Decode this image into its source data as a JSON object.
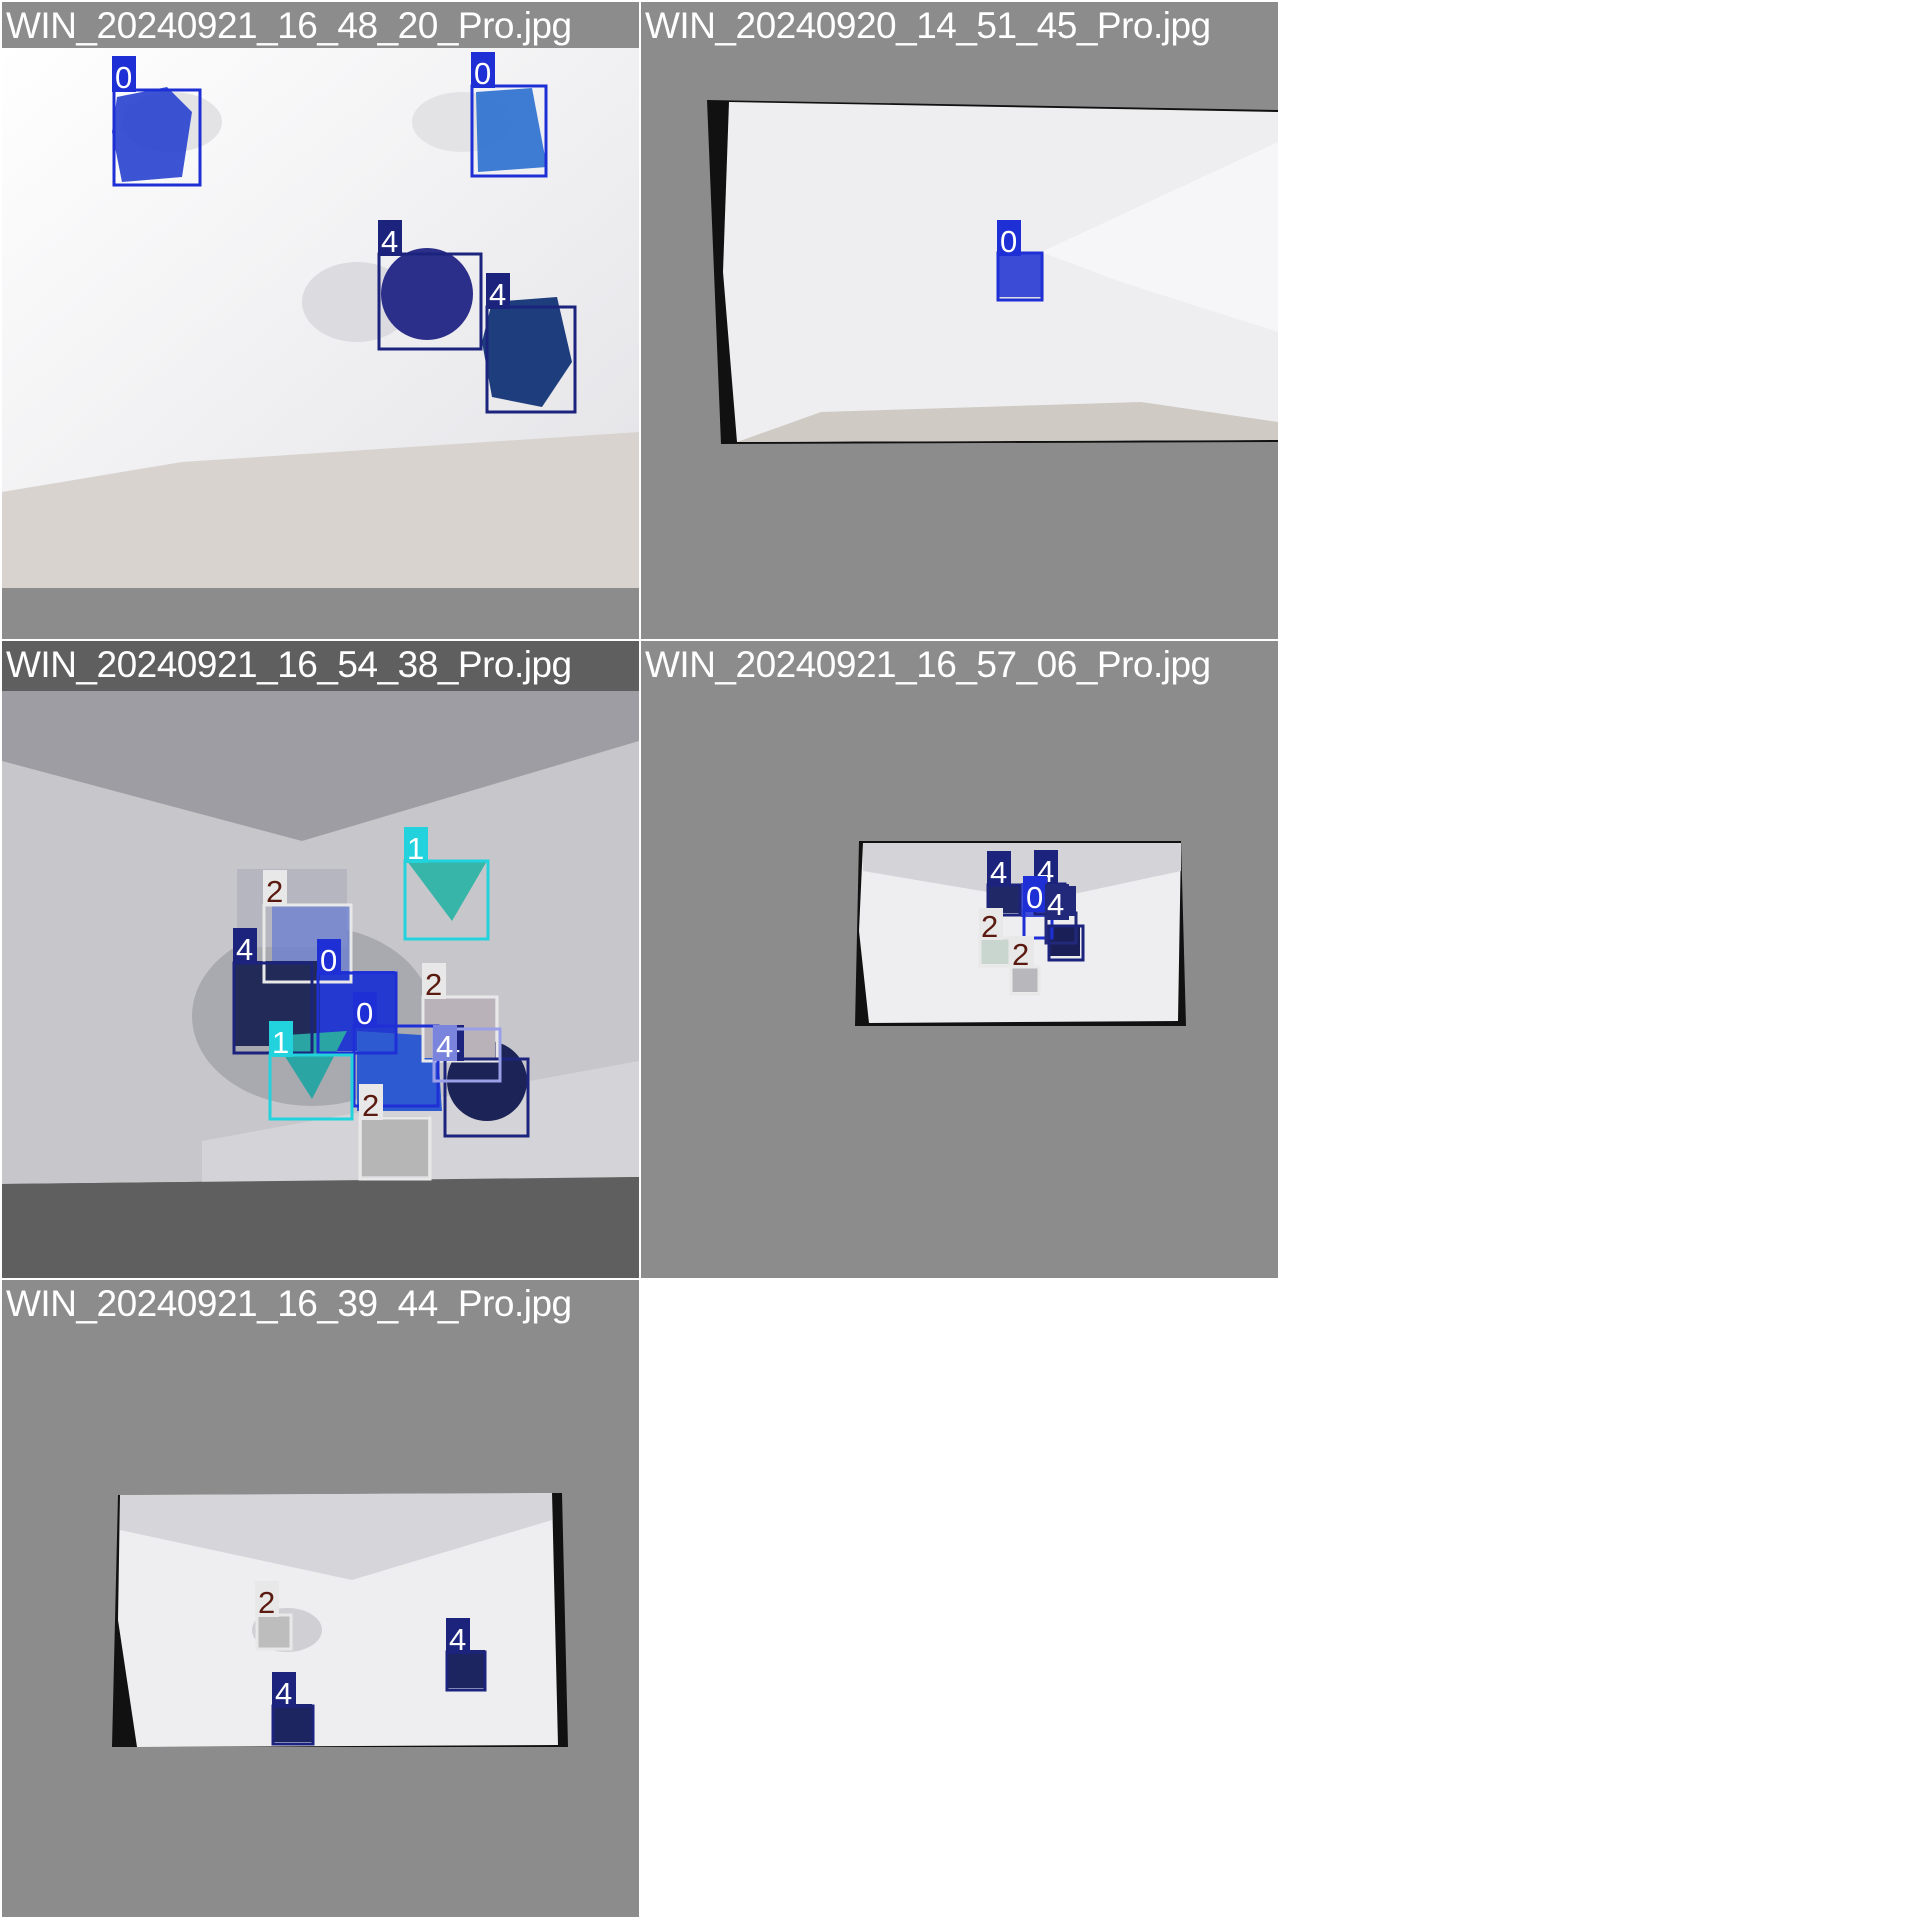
{
  "grid": {
    "background": "#ffffff",
    "tile_background": "#8c8c8c"
  },
  "class_colors": {
    "0": "#1f2fd6",
    "1": "#22d3dd",
    "2": "#e8e8e8",
    "4": "#1b237c"
  },
  "tiles": [
    {
      "filename": "WIN_20240921_16_48_20_Pro.jpg",
      "detections": [
        {
          "label": "0"
        },
        {
          "label": "0"
        },
        {
          "label": "4"
        },
        {
          "label": "4"
        }
      ]
    },
    {
      "filename": "WIN_20240920_14_51_45_Pro.jpg",
      "detections": [
        {
          "label": "0"
        }
      ]
    },
    {
      "filename": "WIN_20240921_16_54_38_Pro.jpg",
      "detections": [
        {
          "label": "1"
        },
        {
          "label": "2"
        },
        {
          "label": "4"
        },
        {
          "label": "0"
        },
        {
          "label": "2"
        },
        {
          "label": "0"
        },
        {
          "label": "1"
        },
        {
          "label": "4"
        },
        {
          "label": "2"
        },
        {
          "label": "4"
        }
      ]
    },
    {
      "filename": "WIN_20240921_16_57_06_Pro.jpg",
      "detections": [
        {
          "label": "4"
        },
        {
          "label": "4"
        },
        {
          "label": "0"
        },
        {
          "label": "4"
        },
        {
          "label": "2"
        },
        {
          "label": "2"
        },
        {
          "label": "4"
        }
      ]
    },
    {
      "filename": "WIN_20240921_16_39_44_Pro.jpg",
      "detections": [
        {
          "label": "2"
        },
        {
          "label": "4"
        },
        {
          "label": "4"
        }
      ]
    }
  ]
}
